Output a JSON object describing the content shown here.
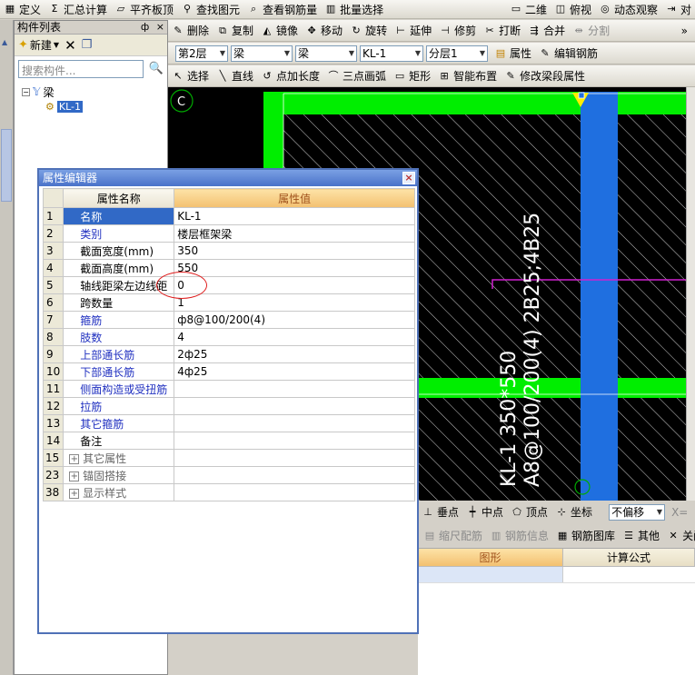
{
  "toolbar1": {
    "items": [
      {
        "icon": "define-icon",
        "label": "定义"
      },
      {
        "icon": "sum-icon",
        "label": "汇总计算"
      },
      {
        "icon": "level-slab-icon",
        "label": "平齐板顶"
      },
      {
        "icon": "find-icon",
        "label": "查找图元"
      },
      {
        "icon": "view-rebar-icon",
        "label": "查看钢筋量"
      },
      {
        "icon": "batch-select-icon",
        "label": "批量选择"
      }
    ],
    "right_items": [
      {
        "icon": "2d-icon",
        "label": "二维"
      },
      {
        "icon": "top-view-icon",
        "label": "俯视"
      },
      {
        "icon": "dynamic-view-icon",
        "label": "动态观察"
      },
      {
        "icon": "align-icon",
        "label": "对"
      }
    ]
  },
  "toolbar2": {
    "items": [
      {
        "icon": "delete-icon",
        "label": "删除"
      },
      {
        "icon": "copy-icon",
        "label": "复制"
      },
      {
        "icon": "mirror-icon",
        "label": "镜像"
      },
      {
        "icon": "move-icon",
        "label": "移动"
      },
      {
        "icon": "rotate-icon",
        "label": "旋转"
      },
      {
        "icon": "extend-icon",
        "label": "延伸"
      },
      {
        "icon": "trim-icon",
        "label": "修剪"
      },
      {
        "icon": "break-icon",
        "label": "打断"
      },
      {
        "icon": "merge-icon",
        "label": "合并"
      },
      {
        "icon": "split-icon",
        "label": "分割"
      }
    ]
  },
  "toolbar3": {
    "floor": "第2层",
    "type1": "梁",
    "type2": "梁",
    "element": "KL-1",
    "sublayer": "分层1",
    "attr_label": "属性",
    "edit_rebar_label": "编辑钢筋"
  },
  "toolbar4": {
    "items": [
      {
        "icon": "select-icon",
        "label": "选择"
      },
      {
        "icon": "line-icon",
        "label": "直线"
      },
      {
        "icon": "point-length-icon",
        "label": "点加长度"
      },
      {
        "icon": "arc-icon",
        "label": "三点画弧"
      },
      {
        "icon": "rect-icon",
        "label": "矩形"
      },
      {
        "icon": "smart-layout-icon",
        "label": "智能布置"
      },
      {
        "icon": "modify-span-icon",
        "label": "修改梁段属性"
      }
    ]
  },
  "left_panel": {
    "title": "构件列表",
    "pin": "ф",
    "close": "×",
    "new_label": "新建",
    "search_placeholder": "搜索构件...",
    "tree_root": "梁",
    "tree_child": "KL-1"
  },
  "canvas": {
    "axis_label": "C",
    "beam_text_line1": "KL-1 350*550",
    "beam_text_line2": "A8@100/200(4) 2B25;4B25"
  },
  "status_strip": {
    "items": [
      {
        "icon": "perpendicular-icon",
        "label": "垂点"
      },
      {
        "icon": "midpoint-icon",
        "label": "中点"
      },
      {
        "icon": "vertex-icon",
        "label": "顶点"
      },
      {
        "icon": "coord-icon",
        "label": "坐标"
      }
    ],
    "offset_label": "不偏移",
    "x_label": "X="
  },
  "lower_panel": {
    "toolbar": [
      {
        "icon": "ruler-rebar-icon",
        "label": "缩尺配筋"
      },
      {
        "icon": "rebar-info-icon",
        "label": "钢筋信息"
      },
      {
        "icon": "rebar-library-icon",
        "label": "钢筋图库"
      },
      {
        "icon": "other-icon",
        "label": "其他"
      },
      {
        "icon": "close-icon",
        "label": "关闭"
      }
    ],
    "columns": [
      "图形",
      "计算公式"
    ]
  },
  "dialog": {
    "title": "属性编辑器",
    "close": "×",
    "header_name": "属性名称",
    "header_value": "属性值",
    "rows": [
      {
        "num": "1",
        "name": "名称",
        "value": "KL-1",
        "style": "selected"
      },
      {
        "num": "2",
        "name": "类别",
        "value": "楼层框架梁",
        "style": "blue"
      },
      {
        "num": "3",
        "name": "截面宽度(mm)",
        "value": "350",
        "style": "black"
      },
      {
        "num": "4",
        "name": "截面高度(mm)",
        "value": "550",
        "style": "black"
      },
      {
        "num": "5",
        "name": "轴线距梁左边线距",
        "value": "0",
        "style": "black"
      },
      {
        "num": "6",
        "name": "跨数量",
        "value": "1",
        "style": "black"
      },
      {
        "num": "7",
        "name": "箍筋",
        "value": "ф8@100/200(4)",
        "style": "blue"
      },
      {
        "num": "8",
        "name": "肢数",
        "value": "4",
        "style": "blue"
      },
      {
        "num": "9",
        "name": "上部通长筋",
        "value": "2ф25",
        "style": "blue"
      },
      {
        "num": "10",
        "name": "下部通长筋",
        "value": "4ф25",
        "style": "blue"
      },
      {
        "num": "11",
        "name": "侧面构造或受扭筋",
        "value": "",
        "style": "blue"
      },
      {
        "num": "12",
        "name": "拉筋",
        "value": "",
        "style": "blue"
      },
      {
        "num": "13",
        "name": "其它箍筋",
        "value": "",
        "style": "blue"
      },
      {
        "num": "14",
        "name": "备注",
        "value": "",
        "style": "black"
      },
      {
        "num": "15",
        "name": "其它属性",
        "value": "",
        "style": "group"
      },
      {
        "num": "23",
        "name": "锚固搭接",
        "value": "",
        "style": "group"
      },
      {
        "num": "38",
        "name": "显示样式",
        "value": "",
        "style": "group"
      }
    ]
  },
  "colors": {
    "canvas_bg": "#000000",
    "beam_green": "#00ee00",
    "column_blue": "#1f6fe0",
    "annotation_magenta": "#d020d0",
    "highlight_red": "#e02020"
  }
}
